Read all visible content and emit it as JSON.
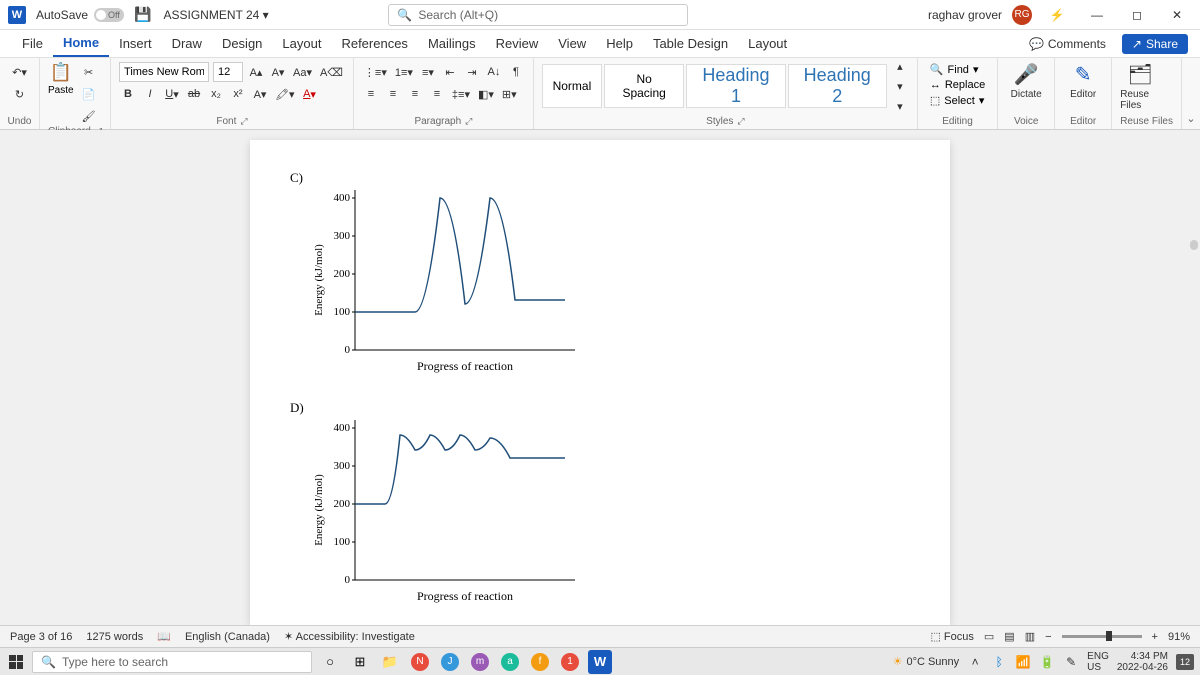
{
  "titlebar": {
    "autosave_label": "AutoSave",
    "autosave_state": "Off",
    "doc_title": "ASSIGNMENT 24 ▾",
    "search_placeholder": "Search (Alt+Q)",
    "user_name": "raghav grover",
    "user_initials": "RG"
  },
  "tabs": {
    "items": [
      "File",
      "Home",
      "Insert",
      "Draw",
      "Design",
      "Layout",
      "References",
      "Mailings",
      "Review",
      "View",
      "Help",
      "Table Design",
      "Layout"
    ],
    "active": "Home",
    "comments": "Comments",
    "share": "Share"
  },
  "ribbon": {
    "undo_label": "Undo",
    "clipboard": {
      "paste": "Paste",
      "label": "Clipboard"
    },
    "font": {
      "name": "Times New Roman",
      "size": "12",
      "label": "Font"
    },
    "paragraph": {
      "label": "Paragraph"
    },
    "styles": {
      "items": [
        "Normal",
        "No Spacing",
        "Heading 1",
        "Heading 2"
      ],
      "label": "Styles"
    },
    "editing": {
      "find": "Find",
      "replace": "Replace",
      "select": "Select",
      "label": "Editing"
    },
    "dictate": "Dictate",
    "voice_label": "Voice",
    "editor": "Editor",
    "editor_label": "Editor",
    "reuse": "Reuse Files",
    "reuse_label": "Reuse Files"
  },
  "chart_data": [
    {
      "type": "line",
      "label": "C)",
      "ylabel": "Energy (kJ/mol)",
      "xlabel": "Progress of reaction",
      "yticks": [
        0,
        100,
        200,
        300,
        400
      ],
      "ylim": [
        0,
        420
      ],
      "points": [
        {
          "x": 0,
          "y": 100
        },
        {
          "x": 60,
          "y": 100
        },
        {
          "x": 85,
          "y": 400
        },
        {
          "x": 110,
          "y": 120
        },
        {
          "x": 135,
          "y": 400
        },
        {
          "x": 160,
          "y": 130
        },
        {
          "x": 210,
          "y": 130
        }
      ]
    },
    {
      "type": "line",
      "label": "D)",
      "ylabel": "Energy (kJ/mol)",
      "xlabel": "Progress of reaction",
      "yticks": [
        0,
        100,
        200,
        300,
        400
      ],
      "ylim": [
        0,
        420
      ],
      "points": [
        {
          "x": 0,
          "y": 200
        },
        {
          "x": 30,
          "y": 200
        },
        {
          "x": 45,
          "y": 380
        },
        {
          "x": 60,
          "y": 340
        },
        {
          "x": 75,
          "y": 380
        },
        {
          "x": 90,
          "y": 340
        },
        {
          "x": 105,
          "y": 380
        },
        {
          "x": 120,
          "y": 340
        },
        {
          "x": 135,
          "y": 370
        },
        {
          "x": 155,
          "y": 320
        },
        {
          "x": 210,
          "y": 320
        }
      ]
    }
  ],
  "statusbar": {
    "page": "Page 3 of 16",
    "words": "1275 words",
    "language": "English (Canada)",
    "accessibility": "Accessibility: Investigate",
    "focus": "Focus",
    "zoom": "91%"
  },
  "taskbar": {
    "search_placeholder": "Type here to search",
    "weather": "0°C Sunny",
    "lang1": "ENG",
    "lang2": "US",
    "time": "4:34 PM",
    "date": "2022-04-26",
    "notif_count": "12"
  }
}
